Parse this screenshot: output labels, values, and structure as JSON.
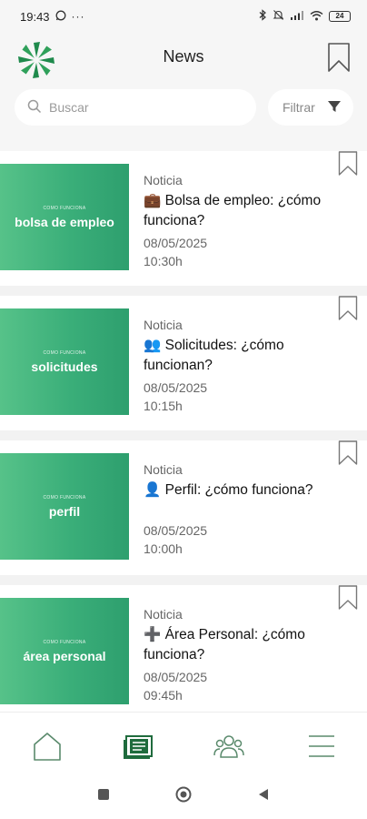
{
  "status_bar": {
    "time": "19:43",
    "battery": "24"
  },
  "header": {
    "title": "News"
  },
  "search": {
    "placeholder": "Buscar"
  },
  "filter": {
    "label": "Filtrar"
  },
  "news": [
    {
      "thumb_small": "COMO FUNCIONA",
      "thumb_big": "bolsa de empleo",
      "category": "Noticia",
      "emoji": "💼",
      "title": "Bolsa de empleo: ¿cómo funciona?",
      "date": "08/05/2025",
      "time": "10:30h"
    },
    {
      "thumb_small": "COMO FUNCIONA",
      "thumb_big": "solicitudes",
      "category": "Noticia",
      "emoji": "👥",
      "title": "Solicitudes: ¿cómo funcionan?",
      "date": "08/05/2025",
      "time": "10:15h"
    },
    {
      "thumb_small": "COMO FUNCIONA",
      "thumb_big": "perfil",
      "category": "Noticia",
      "emoji": "👤",
      "title": "Perfil: ¿cómo funciona?",
      "date": "08/05/2025",
      "time": "10:00h"
    },
    {
      "thumb_small": "COMO FUNCIONA",
      "thumb_big": "área personal",
      "category": "Noticia",
      "emoji": "➕",
      "title": "Área Personal: ¿cómo funciona?",
      "date": "08/05/2025",
      "time": "09:45h"
    }
  ],
  "nav": {
    "items": [
      "home-icon",
      "news-icon",
      "community-icon",
      "menu-icon"
    ],
    "active": "news-icon"
  },
  "colors": {
    "brand": "#2e8b57",
    "thumb": "#3aae79",
    "icon": "#4a7a5c"
  }
}
